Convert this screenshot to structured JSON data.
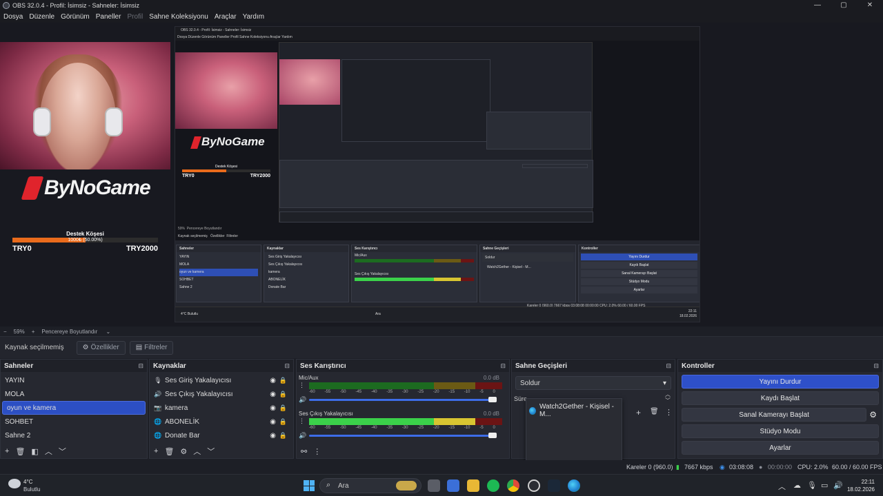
{
  "window": {
    "title": "OBS 32.0.4 - Profil: İsimsiz - Sahneler: İsimsiz",
    "controls": [
      "—",
      "▢",
      "✕"
    ]
  },
  "menu": {
    "items": [
      "Dosya",
      "Düzenle",
      "Görünüm",
      "Paneller",
      "Profil",
      "Sahne Koleksiyonu",
      "Araçlar",
      "Yardım"
    ],
    "disabled": [
      "Profil"
    ]
  },
  "preview": {
    "logo_text": "ByNoGame",
    "goal_title": "Destek Köşesi",
    "goal_progress_text": "1000₺ (50.00%)",
    "goal_progress": 0.5,
    "goal_start": "TRY0",
    "goal_end": "TRY2000",
    "nested_logo_text": "ByNoGame",
    "nested_goal_title": "Destek Köşesi",
    "nested_goal_start": "TRY0",
    "nested_goal_end": "TRY2000",
    "nested_title": "OBS 32.0.4 - Profil: İsimsiz - Sahneler: İsimsiz",
    "nested_menu": "Dosya  Düzenle  Görünüm  Paneller  Profil  Sahne Koleksiyonu  Araçlar  Yardım",
    "nested_srcbar": "Kaynak seçilmemiş",
    "nested_props": "Özellikler",
    "nested_filters": "Filtreler",
    "nested_zoom": "59%",
    "nested_resize": "Pencereye Boyutlandır",
    "nested_panels": [
      "Sahneler",
      "Kaynaklar",
      "Ses Karıştırıcı",
      "Sahne Geçişleri",
      "Kontroller"
    ],
    "nested_scenes": [
      "YAYIN",
      "MOLA",
      "oyun ve kamera",
      "SOHBET",
      "Sahne 2"
    ],
    "nested_sources": [
      "Ses Giriş Yakalayıcısı",
      "Ses Çıkış Yakalayıcısı",
      "kamera",
      "ABONELİK",
      "Donate Bar"
    ],
    "nested_controls": [
      "Yayını Durdur",
      "Kaydı Başlat",
      "Sanal Kamerayı Başlat",
      "Stüdyo Modu",
      "Ayarlar"
    ],
    "nested_transition": "Soldur",
    "nested_w2g": "Watch2Gether - Kişisel - M...",
    "nested_mixer_ch1": "Mic/Aux",
    "nested_mixer_ch2": "Ses Çıkış Yakalayıcısı",
    "nested_status": "Kareler 0 (960.0)   7667 kbps   03:08:08   00:00:00   CPU: 2.0%   60.00 / 60.00 FPS",
    "nested_weather": "4°C Bulutlu",
    "nested_search": "Ara",
    "nested_clock": "22:11",
    "nested_date": "18.02.2026"
  },
  "zoom": {
    "minus": "−",
    "value": "59%",
    "plus": "+",
    "fit_label": "Pencereye Boyutlandır",
    "chevron": "⌄"
  },
  "source_toolbar": {
    "no_selection": "Kaynak seçilmemiş",
    "properties": "Özellikler",
    "filters": "Filtreler"
  },
  "scenes": {
    "title": "Sahneler",
    "items": [
      "YAYIN",
      "MOLA",
      "oyun ve kamera",
      "SOHBET",
      "Sahne 2"
    ],
    "active_index": 2
  },
  "sources": {
    "title": "Kaynaklar",
    "items": [
      {
        "icon": "mic-icon",
        "label": "Ses Giriş Yakalayıcısı"
      },
      {
        "icon": "speaker-icon",
        "label": "Ses Çıkış Yakalayıcısı"
      },
      {
        "icon": "camera-icon",
        "label": "kamera"
      },
      {
        "icon": "globe-icon",
        "label": "ABONELİK"
      },
      {
        "icon": "globe-icon",
        "label": "Donate Bar"
      }
    ]
  },
  "mixer": {
    "title": "Ses Karıştırıcı",
    "channels": [
      {
        "name": "Mic/Aux",
        "db": "0.0 dB",
        "level": 0.0
      },
      {
        "name": "Ses Çıkış Yakalayıcısı",
        "db": "0.0 dB",
        "level": 0.88
      }
    ],
    "scale": [
      "-60",
      "-55",
      "-50",
      "-45",
      "-40",
      "-35",
      "-30",
      "-25",
      "-20",
      "-15",
      "-10",
      "-5",
      "0"
    ]
  },
  "transitions": {
    "title": "Sahne Geçişleri",
    "selected": "Soldur",
    "duration_label": "Süre",
    "tooltip_item": "Watch2Gether - Kişisel - M..."
  },
  "controls": {
    "title": "Kontroller",
    "buttons": [
      "Yayını Durdur",
      "Kaydı Başlat",
      "Sanal Kamerayı Başlat",
      "Stüdyo Modu",
      "Ayarlar"
    ]
  },
  "status": {
    "dropped": "Kareler 0 (960.0)",
    "bitrate": "7667 kbps",
    "stream_time": "03:08:08",
    "rec_time": "00:00:00",
    "cpu": "CPU: 2.0%",
    "fps": "60.00 / 60.00 FPS"
  },
  "taskbar": {
    "temp": "4°C",
    "weather": "Bulutlu",
    "search_placeholder": "Ara",
    "time": "22:11",
    "date": "18.02.2026"
  },
  "colors": {
    "accent": "#2e50c9",
    "brand_red": "#e0242c",
    "goal_orange": "#e96b1c",
    "meter_green": "#3bd14a",
    "meter_yellow": "#d8c531"
  }
}
